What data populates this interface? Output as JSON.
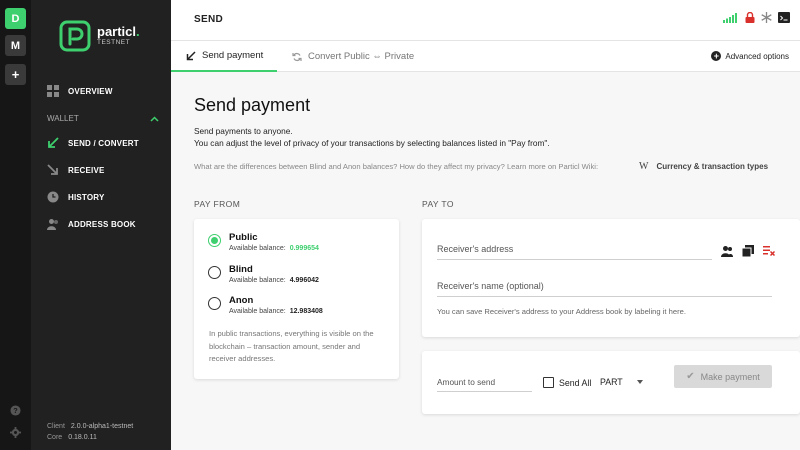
{
  "wallets": {
    "items": [
      {
        "letter": "D",
        "color": "#3ecf6e"
      },
      {
        "letter": "M",
        "color": "#3a3a3a"
      }
    ],
    "add_label": "+"
  },
  "brand": {
    "name": "particl",
    "dot": ".",
    "network": "TESTNET"
  },
  "sidebar": {
    "overview": "OVERVIEW",
    "section_label": "WALLET",
    "items": [
      {
        "label": "SEND / CONVERT",
        "icon": "send-icon",
        "active": true
      },
      {
        "label": "RECEIVE",
        "icon": "receive-icon"
      },
      {
        "label": "HISTORY",
        "icon": "history-icon"
      },
      {
        "label": "ADDRESS BOOK",
        "icon": "address-book-icon"
      }
    ],
    "client_label": "Client",
    "client_version": "2.0.0-alpha1-testnet",
    "core_label": "Core",
    "core_version": "0.18.0.11"
  },
  "header": {
    "title": "SEND",
    "status_icons": [
      "signal-bars-icon",
      "lock-icon",
      "staking-icon",
      "console-icon"
    ]
  },
  "tabs": [
    {
      "label": "Send payment",
      "active": true
    },
    {
      "label": "Convert Public ⇔ Private",
      "active": false
    }
  ],
  "advanced_options": "Advanced options",
  "page": {
    "title": "Send payment",
    "intro_line1": "Send payments to anyone.",
    "intro_line2": "You can adjust the level of privacy of your transactions by selecting balances listed in \"Pay from\".",
    "wiki_question": "What are the differences between Blind and Anon balances? How do they affect my privacy? Learn more on Particl Wiki:",
    "wiki_link": "Currency & transaction types",
    "wiki_glyph": "W"
  },
  "pay_from": {
    "label": "PAY FROM",
    "balance_prefix": "Available balance:",
    "options": [
      {
        "name": "Public",
        "balance": "0.999654",
        "selected": true
      },
      {
        "name": "Blind",
        "balance": "4.996042",
        "selected": false
      },
      {
        "name": "Anon",
        "balance": "12.983408",
        "selected": false
      }
    ],
    "note": "In public transactions, everything is visible on the blockchain – transaction amount, sender and receiver addresses."
  },
  "pay_to": {
    "label": "PAY TO",
    "address_placeholder": "Receiver's address",
    "name_placeholder": "Receiver's name (optional)",
    "note": "You can save Receiver's address to your Address book by labeling it here."
  },
  "amount": {
    "placeholder": "Amount to send",
    "send_all_label": "Send All",
    "currency": "PART",
    "submit_label": "Make payment"
  },
  "colors": {
    "accent": "#3ecf6e",
    "sidebar_bg": "#212121",
    "rail_bg": "#161616",
    "danger": "#d9302c"
  }
}
